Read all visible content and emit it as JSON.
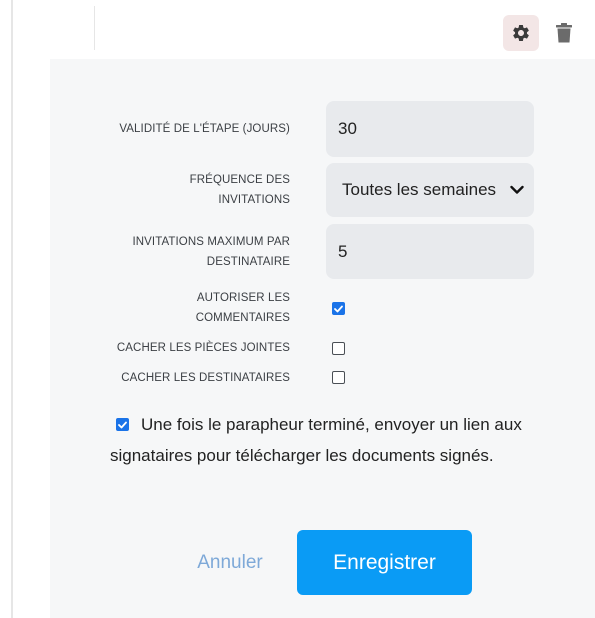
{
  "toolbar": {
    "settings_icon": "gear-icon",
    "delete_icon": "trash-icon"
  },
  "form": {
    "step_validity": {
      "label": "VALIDITÉ DE L'ÉTAPE (JOURS)",
      "value": "30"
    },
    "invitation_frequency": {
      "label_line1": "FRÉQUENCE DES",
      "label_line2": "INVITATIONS",
      "selected": "Toutes les semaines"
    },
    "max_invitations": {
      "label_line1": "INVITATIONS MAXIMUM PAR",
      "label_line2": "DESTINATAIRE",
      "value": "5"
    },
    "allow_comments": {
      "label_line1": "AUTORISER LES",
      "label_line2": "COMMENTAIRES",
      "checked": true
    },
    "hide_attachments": {
      "label": "CACHER LES PIÈCES JOINTES",
      "checked": false
    },
    "hide_recipients": {
      "label": "CACHER LES DESTINATAIRES",
      "checked": false
    }
  },
  "notice": {
    "checked": true,
    "text": "Une fois le parapheur terminé, envoyer un lien aux signataires pour télécharger les documents signés."
  },
  "actions": {
    "cancel_label": "Annuler",
    "save_label": "Enregistrer"
  },
  "colors": {
    "primary": "#0a9bf5",
    "checkbox": "#1a73e8",
    "cancel_text": "#7ea9d8",
    "panel_bg": "#f6f7f8",
    "input_bg": "#e8eaed"
  }
}
